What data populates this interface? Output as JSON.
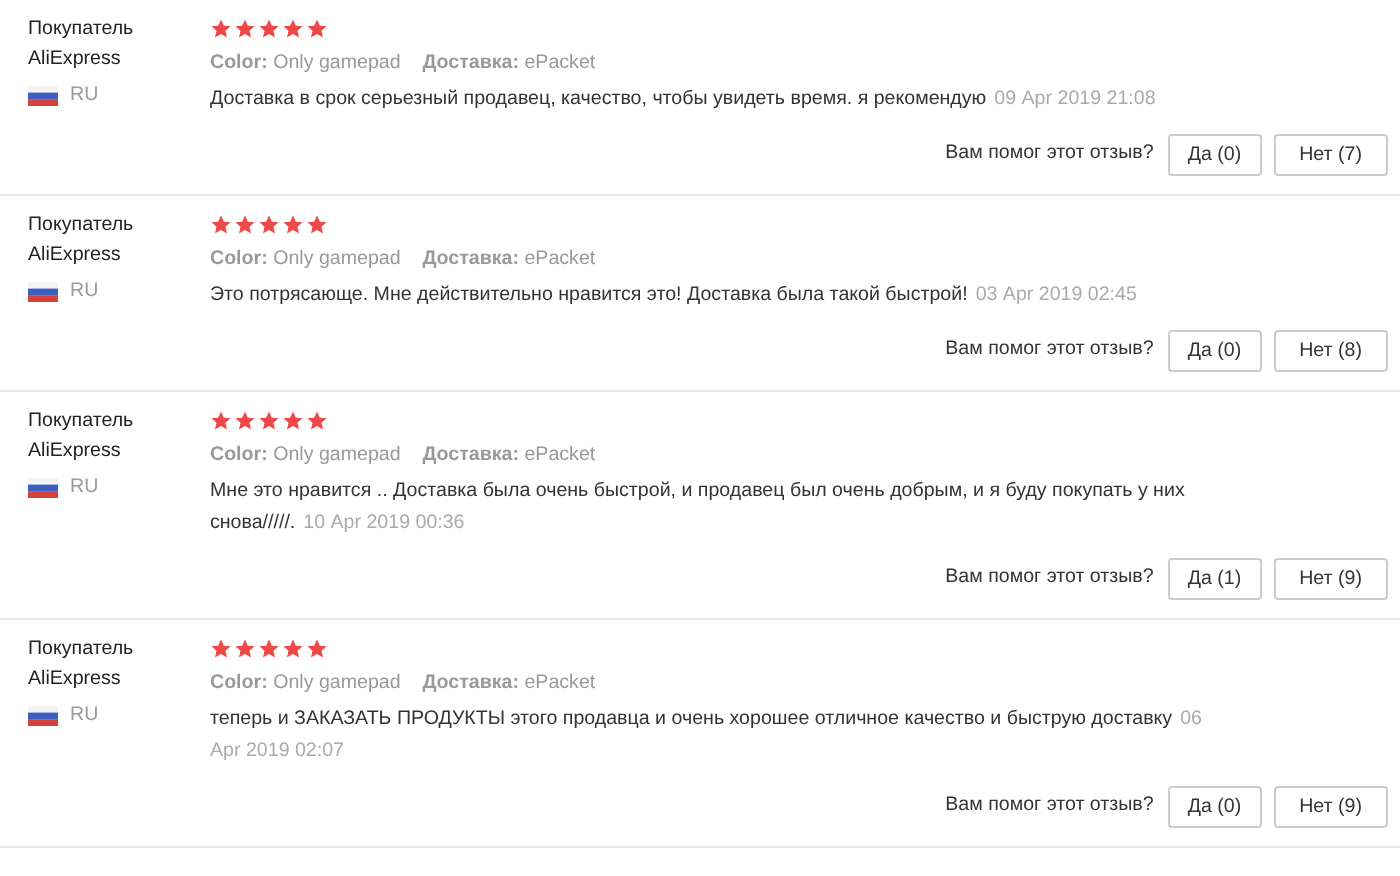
{
  "reviews": [
    {
      "author": "Покупатель AliExpress",
      "country": "RU",
      "stars": 5,
      "color_label": "Color:",
      "color_value": "Only gamepad",
      "shipping_label": "Доставка:",
      "shipping_value": "ePacket",
      "text": "Доставка в срок серьезный продавец, качество, чтобы увидеть время. я рекомендую",
      "date": "09 Apr 2019 21:08",
      "helpful_question": "Вам помог этот отзыв?",
      "yes": "Да (0)",
      "no": "Нет (7)"
    },
    {
      "author": "Покупатель AliExpress",
      "country": "RU",
      "stars": 5,
      "color_label": "Color:",
      "color_value": "Only gamepad",
      "shipping_label": "Доставка:",
      "shipping_value": "ePacket",
      "text": "Это потрясающе. Мне действительно нравится это! Доставка была такой быстрой!",
      "date": "03 Apr 2019 02:45",
      "helpful_question": "Вам помог этот отзыв?",
      "yes": "Да (0)",
      "no": "Нет (8)"
    },
    {
      "author": "Покупатель AliExpress",
      "country": "RU",
      "stars": 5,
      "color_label": "Color:",
      "color_value": "Only gamepad",
      "shipping_label": "Доставка:",
      "shipping_value": "ePacket",
      "text": "Мне это нравится .. Доставка была очень быстрой, и продавец был очень добрым, и я буду покупать у них снова/////.",
      "date": "10 Apr 2019 00:36",
      "helpful_question": "Вам помог этот отзыв?",
      "yes": "Да (1)",
      "no": "Нет (9)"
    },
    {
      "author": "Покупатель AliExpress",
      "country": "RU",
      "stars": 5,
      "color_label": "Color:",
      "color_value": "Only gamepad",
      "shipping_label": "Доставка:",
      "shipping_value": "ePacket",
      "text": "теперь и ЗАКАЗАТЬ ПРОДУКТЫ этого продавца и очень хорошее отличное качество и быструю доставку",
      "date": "06 Apr 2019 02:07",
      "helpful_question": "Вам помог этот отзыв?",
      "yes": "Да (0)",
      "no": "Нет (9)"
    }
  ]
}
